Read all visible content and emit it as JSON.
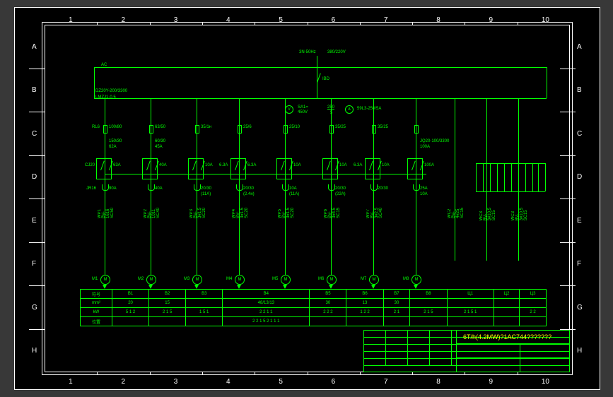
{
  "zones": {
    "rows": [
      "A",
      "B",
      "C",
      "D",
      "E",
      "F",
      "G",
      "H"
    ],
    "cols": [
      "1",
      "2",
      "3",
      "4",
      "5",
      "6",
      "7",
      "8",
      "9",
      "10"
    ]
  },
  "header": {
    "freq": "3N-50Hz",
    "voltage": "380/220V",
    "ac": "AC",
    "busA": "IBD",
    "spec1": "DZ20Y-200/3300",
    "spec2": "LMZJ1-0.5",
    "meterV": "V",
    "sa_label": "SA1=",
    "sa_val": "450V",
    "ratio": "250",
    "ratio_den": "5",
    "meterA": "A",
    "ct": "59L3-250/5A"
  },
  "branches": [
    {
      "id": "b1",
      "top": "RL6",
      "r1": "100/80",
      "r2": "150/30",
      "r2b": "62A",
      "c1": "CJ20",
      "c2": "63A",
      "th": "JR16",
      "th2": "90A",
      "wire": "WP1 BV-1616 SC50",
      "motor": "M1"
    },
    {
      "id": "b2",
      "top": "",
      "r1": "63/50",
      "r2": "60/30",
      "r2b": "45A",
      "c1": "",
      "c2": "40A",
      "th": "",
      "th2": "40A",
      "wire": "WP2 BV-1011 SC40",
      "motor": "M2"
    },
    {
      "id": "b3",
      "top": "",
      "r1": "35/1н",
      "r2": "",
      "r2b": "",
      "c1": "",
      "c2": "10A",
      "th": "",
      "th2": "20/30",
      "th3": "(11A)",
      "wire": "WP3 BV-3#1.5 SC20",
      "motor": "M3"
    },
    {
      "id": "b4",
      "top": "",
      "r1": "25/6",
      "r2": "",
      "r2b": "",
      "c1": "6.3A",
      "c2": "6.3A",
      "th": "",
      "th2": "20/30",
      "th3": "(2.4н)",
      "wire": "WP4 BV-3#1.5 SC20",
      "motor": "M4"
    },
    {
      "id": "b5",
      "top": "",
      "r1": "25/10",
      "r2": "",
      "r2b": "",
      "c1": "",
      "c2": "10A",
      "th": "",
      "th2": "10A",
      "th3": "(11A)",
      "wire": "WP5 BV-3#1.5 SC20",
      "motor": "M5"
    },
    {
      "id": "b6",
      "top": "",
      "r1": "35/25",
      "r2": "",
      "r2b": "",
      "c1": "",
      "c2": "10A",
      "th": "",
      "th2": "20/30",
      "th3": "(22A)",
      "wire": "WP6 BV-3#4.5 SC15",
      "motor": "M6"
    },
    {
      "id": "b7",
      "top": "",
      "r1": "35/25",
      "r2": "",
      "r2b": "",
      "c1": "6.3A",
      "c2": "10A",
      "th": "",
      "th2": "20/30",
      "wire": "WP7 BV-3#2.5 SC40",
      "motor": "M7"
    },
    {
      "id": "b8",
      "top": "",
      "r1": "",
      "r2": "JQ20-100/3300",
      "r2b": "100A",
      "c1": "",
      "c2": "100A",
      "th": "",
      "th2": "25A",
      "th3": "10A",
      "wire": "",
      "motor": "M8"
    },
    {
      "id": "b9",
      "wire": "WC2 BV-4#25 SC15",
      "motor": ""
    },
    {
      "id": "b10",
      "wire": "WC3 BV-3#10.5 SC15",
      "motor": ""
    },
    {
      "id": "b11",
      "wire": "WC3 BV-3#10.5 SC15",
      "motor": ""
    }
  ],
  "table": {
    "rows": [
      {
        "h": "符号",
        "c": [
          "B1",
          "B2",
          "B3",
          "B4",
          "B5",
          "B6",
          "B7",
          "B8",
          "Ц1",
          "Ц2",
          "Ц3"
        ]
      },
      {
        "h": "mm²",
        "c": [
          "20",
          "15",
          "",
          "48/13/13",
          "30",
          "13",
          "30",
          "",
          "",
          "",
          ""
        ]
      },
      {
        "h": "kW",
        "c": [
          "5 1 2",
          "2 1 5",
          "1 5 1",
          "2 2 1 1",
          "2 2 2",
          "1 2 2",
          "2 1",
          "2 1 5",
          "2 1 5 1",
          "",
          "2 2"
        ]
      },
      {
        "h": "位置",
        "c": [
          "",
          "",
          "",
          "2 2 1 5 2 1 1 1",
          "",
          "",
          "",
          "",
          "",
          "",
          ""
        ]
      }
    ]
  },
  "title_block": {
    "title": "6T/h(4.2MW)?1AC744???????"
  }
}
